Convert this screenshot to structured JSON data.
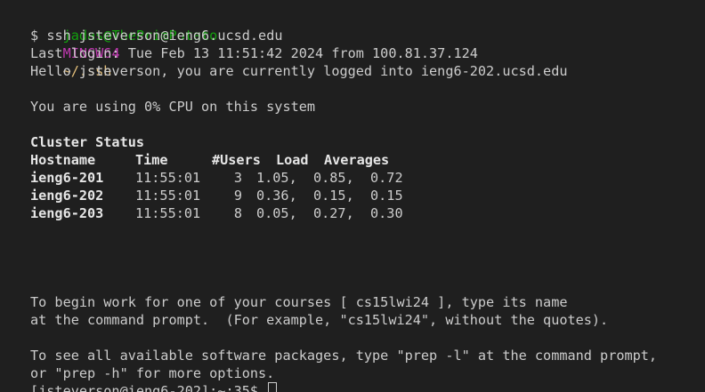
{
  "prompt_header": {
    "user_host": "jadas@ThePrimPotato",
    "env": "MINGW64",
    "path": "~/.ssh"
  },
  "command": {
    "prefix": "$",
    "text": "ssh jsteverson@ieng6.ucsd.edu"
  },
  "last_login": "Last login: Tue Feb 13 11:51:42 2024 from 100.81.37.124",
  "hello": "Hello jsteverson, you are currently logged into ieng6-202.ucsd.edu",
  "cpu": "You are using 0% CPU on this system",
  "cluster": {
    "title": "Cluster Status",
    "headers": [
      "Hostname",
      "Time",
      "#Users",
      "Load",
      "Averages"
    ],
    "rows": [
      {
        "host": "ieng6-201",
        "time": "11:55:01",
        "users": "3",
        "loads": "1.05,  0.85,  0.72"
      },
      {
        "host": "ieng6-202",
        "time": "11:55:01",
        "users": "9",
        "loads": "0.36,  0.15,  0.15"
      },
      {
        "host": "ieng6-203",
        "time": "11:55:01",
        "users": "8",
        "loads": "0.05,  0.27,  0.30"
      }
    ]
  },
  "courses_msg": {
    "line1": "To begin work for one of your courses [ cs15lwi24 ], type its name",
    "line2": "at the command prompt.  (For example, \"cs15lwi24\", without the quotes)."
  },
  "packages_msg": {
    "line1": "To see all available software packages, type \"prep -l\" at the command prompt,",
    "line2": "or \"prep -h\" for more options."
  },
  "remote_prompt": "[jsteverson@ieng6-202]:~:35$"
}
